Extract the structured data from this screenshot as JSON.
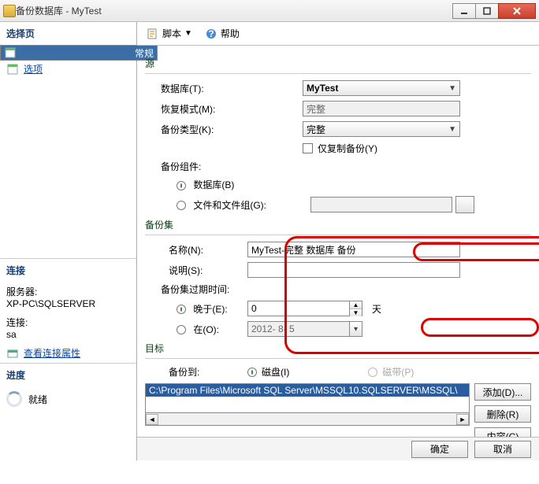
{
  "window": {
    "title": "备份数据库 - MyTest"
  },
  "sidebar": {
    "header": "选择页",
    "items": [
      {
        "label": "常规"
      },
      {
        "label": "选项"
      }
    ],
    "connection_header": "连接",
    "server_label": "服务器:",
    "server_value": "XP-PC\\SQLSERVER",
    "conn_label": "连接:",
    "conn_value": "sa",
    "view_conn_link": "查看连接属性",
    "progress_header": "进度",
    "status": "就绪"
  },
  "toolbar": {
    "script_label": "脚本",
    "help_label": "帮助"
  },
  "source": {
    "group": "源",
    "database_label": "数据库(T):",
    "database_value": "MyTest",
    "recovery_label": "恢复模式(M):",
    "recovery_value": "完整",
    "backup_type_label": "备份类型(K):",
    "backup_type_value": "完整",
    "copy_only_label": "仅复制备份(Y)",
    "component_label": "备份组件:",
    "component_db": "数据库(B)",
    "component_fg": "文件和文件组(G):"
  },
  "backupset": {
    "group": "备份集",
    "name_label": "名称(N):",
    "name_value": "MyTest-完整 数据库 备份",
    "desc_label": "说明(S):",
    "desc_value": "",
    "expire_label": "备份集过期时间:",
    "after_label": "晚于(E):",
    "after_value": "0",
    "after_unit": "天",
    "on_label": "在(O):",
    "on_value": "2012- 8- 5"
  },
  "destination": {
    "group": "目标",
    "backupto_label": "备份到:",
    "disk_label": "磁盘(I)",
    "tape_label": "磁带(P)",
    "path": "C:\\Program Files\\Microsoft SQL Server\\MSSQL10.SQLSERVER\\MSSQL\\",
    "add_btn": "添加(D)...",
    "remove_btn": "删除(R)",
    "contents_btn": "内容(C)"
  },
  "footer": {
    "ok": "确定",
    "cancel": "取消"
  }
}
